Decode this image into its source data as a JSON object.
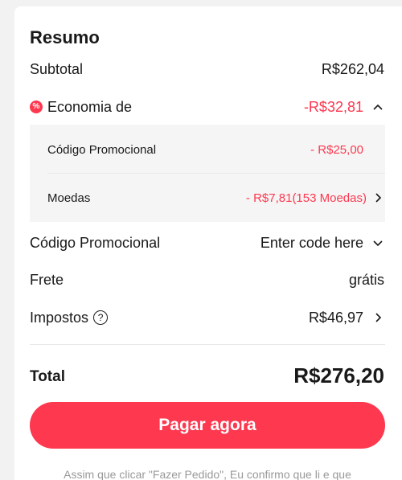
{
  "summary": {
    "title": "Resumo",
    "subtotal_label": "Subtotal",
    "subtotal_value": "R$262,04",
    "savings_label": "Economia de",
    "savings_value": "-R$32,81",
    "savings_breakdown": {
      "promo_label": "Código Promocional",
      "promo_value": "- R$25,00",
      "coins_label": "Moedas",
      "coins_value": "- R$7,81(153 Moedas)"
    },
    "promo_code_label": "Código Promocional",
    "promo_code_placeholder": "Enter code here",
    "shipping_label": "Frete",
    "shipping_value": "grátis",
    "taxes_label": "Impostos",
    "taxes_value": "R$46,97",
    "total_label": "Total",
    "total_value": "R$276,20",
    "pay_button_label": "Pagar agora",
    "disclaimer": "Assim que clicar \"Fazer Pedido\", Eu confirmo que li e que"
  },
  "colors": {
    "accent": "#fd384f",
    "text": "#191919",
    "muted": "#999999"
  },
  "icons": {
    "savings": "discount-badge-icon",
    "expand": "chevron-up-icon",
    "coins_detail": "chevron-right-icon",
    "promo_dropdown": "chevron-down-icon",
    "taxes_help": "question-circle-icon",
    "taxes_detail": "chevron-right-icon"
  }
}
